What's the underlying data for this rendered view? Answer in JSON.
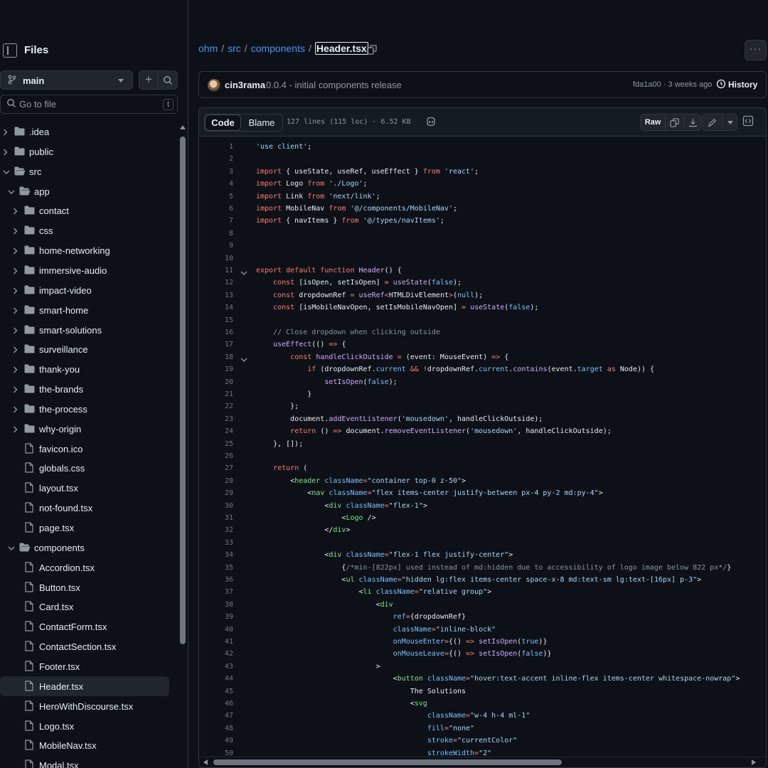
{
  "sidebar": {
    "title": "Files",
    "branch": "main",
    "goto_placeholder": "Go to file",
    "goto_shortcut": "t",
    "tree": [
      {
        "label": ".idea",
        "type": "folder",
        "depth": 0,
        "expanded": false
      },
      {
        "label": "public",
        "type": "folder",
        "depth": 0,
        "expanded": false
      },
      {
        "label": "src",
        "type": "folder",
        "depth": 0,
        "expanded": true
      },
      {
        "label": "app",
        "type": "folder",
        "depth": 1,
        "expanded": true
      },
      {
        "label": "contact",
        "type": "folder",
        "depth": 2,
        "expanded": false
      },
      {
        "label": "css",
        "type": "folder",
        "depth": 2,
        "expanded": false
      },
      {
        "label": "home-networking",
        "type": "folder",
        "depth": 2,
        "expanded": false
      },
      {
        "label": "immersive-audio",
        "type": "folder",
        "depth": 2,
        "expanded": false
      },
      {
        "label": "impact-video",
        "type": "folder",
        "depth": 2,
        "expanded": false
      },
      {
        "label": "smart-home",
        "type": "folder",
        "depth": 2,
        "expanded": false
      },
      {
        "label": "smart-solutions",
        "type": "folder",
        "depth": 2,
        "expanded": false
      },
      {
        "label": "surveillance",
        "type": "folder",
        "depth": 2,
        "expanded": false
      },
      {
        "label": "thank-you",
        "type": "folder",
        "depth": 2,
        "expanded": false
      },
      {
        "label": "the-brands",
        "type": "folder",
        "depth": 2,
        "expanded": false
      },
      {
        "label": "the-process",
        "type": "folder",
        "depth": 2,
        "expanded": false
      },
      {
        "label": "why-origin",
        "type": "folder",
        "depth": 2,
        "expanded": false
      },
      {
        "label": "favicon.ico",
        "type": "file",
        "depth": 2
      },
      {
        "label": "globals.css",
        "type": "file",
        "depth": 2
      },
      {
        "label": "layout.tsx",
        "type": "file",
        "depth": 2
      },
      {
        "label": "not-found.tsx",
        "type": "file",
        "depth": 2
      },
      {
        "label": "page.tsx",
        "type": "file",
        "depth": 2
      },
      {
        "label": "components",
        "type": "folder",
        "depth": 1,
        "expanded": true
      },
      {
        "label": "Accordion.tsx",
        "type": "file",
        "depth": 2
      },
      {
        "label": "Button.tsx",
        "type": "file",
        "depth": 2
      },
      {
        "label": "Card.tsx",
        "type": "file",
        "depth": 2
      },
      {
        "label": "ContactForm.tsx",
        "type": "file",
        "depth": 2
      },
      {
        "label": "ContactSection.tsx",
        "type": "file",
        "depth": 2
      },
      {
        "label": "Footer.tsx",
        "type": "file",
        "depth": 2
      },
      {
        "label": "Header.tsx",
        "type": "file",
        "depth": 2,
        "selected": true
      },
      {
        "label": "HeroWithDiscourse.tsx",
        "type": "file",
        "depth": 2
      },
      {
        "label": "Logo.tsx",
        "type": "file",
        "depth": 2
      },
      {
        "label": "MobileNav.tsx",
        "type": "file",
        "depth": 2
      },
      {
        "label": "Modal.tsx",
        "type": "file",
        "depth": 2
      }
    ]
  },
  "breadcrumb": {
    "repo": "ohm",
    "dir1": "src",
    "dir2": "components",
    "sep": "/",
    "file": "Header.tsx"
  },
  "commit": {
    "author": "cin3rama",
    "message": "0.0.4 - initial components release",
    "meta": "fda1a00 · 3 weeks ago",
    "history_label": "History"
  },
  "file_header": {
    "code_tab": "Code",
    "blame_tab": "Blame",
    "info": "127 lines (115 loc) · 6.52 KB",
    "raw_label": "Raw"
  },
  "code_lines": [
    {
      "n": "1",
      "fold": false,
      "html": "<span class=\"s\">'use client'</span>;"
    },
    {
      "n": "2",
      "fold": false,
      "html": ""
    },
    {
      "n": "3",
      "fold": false,
      "html": "<span class=\"k\">import</span> { useState, useRef, useEffect } <span class=\"k\">from</span> <span class=\"s\">'react'</span>;"
    },
    {
      "n": "4",
      "fold": false,
      "html": "<span class=\"k\">import</span> Logo <span class=\"k\">from</span> <span class=\"s\">'./Logo'</span>;"
    },
    {
      "n": "5",
      "fold": false,
      "html": "<span class=\"k\">import</span> Link <span class=\"k\">from</span> <span class=\"s\">'next/link'</span>;"
    },
    {
      "n": "6",
      "fold": false,
      "html": "<span class=\"k\">import</span> MobileNav <span class=\"k\">from</span> <span class=\"s\">'@/components/MobileNav'</span>;"
    },
    {
      "n": "7",
      "fold": false,
      "html": "<span class=\"k\">import</span> { navItems } <span class=\"k\">from</span> <span class=\"s\">'@/types/navItems'</span>;"
    },
    {
      "n": "8",
      "fold": false,
      "html": ""
    },
    {
      "n": "9",
      "fold": false,
      "html": ""
    },
    {
      "n": "10",
      "fold": false,
      "html": ""
    },
    {
      "n": "11",
      "fold": true,
      "html": "<span class=\"k\">export default function</span> <span class=\"f\">Header</span>() {"
    },
    {
      "n": "12",
      "fold": false,
      "html": "    <span class=\"k\">const</span> [isOpen, setIsOpen] <span class=\"k\">=</span> <span class=\"f\">useState</span>(<span class=\"v\">false</span>);"
    },
    {
      "n": "13",
      "fold": false,
      "html": "    <span class=\"k\">const</span> dropdownRef <span class=\"k\">=</span> <span class=\"f\">useRef</span><span class=\"k\">&lt;</span>HTMLDivElement<span class=\"k\">&gt;</span>(<span class=\"v\">null</span>);"
    },
    {
      "n": "14",
      "fold": false,
      "html": "    <span class=\"k\">const</span> [isMobileNavOpen, setIsMobileNavOpen] <span class=\"k\">=</span> <span class=\"f\">useState</span>(<span class=\"v\">false</span>);"
    },
    {
      "n": "15",
      "fold": false,
      "html": ""
    },
    {
      "n": "16",
      "fold": false,
      "html": "    <span class=\"c\">// Close dropdown when clicking outside</span>"
    },
    {
      "n": "17",
      "fold": false,
      "html": "    <span class=\"f\">useEffect</span>(() <span class=\"k\">=&gt;</span> {"
    },
    {
      "n": "18",
      "fold": true,
      "html": "        <span class=\"k\">const</span> <span class=\"f\">handleClickOutside</span> <span class=\"k\">=</span> (event: MouseEvent) <span class=\"k\">=&gt;</span> {"
    },
    {
      "n": "19",
      "fold": false,
      "html": "            <span class=\"k\">if</span> (dropdownRef.<span class=\"v\">current</span> <span class=\"k\">&amp;&amp;</span> <span class=\"k\">!</span>dropdownRef.<span class=\"v\">current</span>.<span class=\"f\">contains</span>(event.<span class=\"v\">target</span> <span class=\"k\">as</span> Node)) {"
    },
    {
      "n": "20",
      "fold": false,
      "html": "                <span class=\"f\">setIsOpen</span>(<span class=\"v\">false</span>);"
    },
    {
      "n": "21",
      "fold": false,
      "html": "            }"
    },
    {
      "n": "22",
      "fold": false,
      "html": "        };"
    },
    {
      "n": "23",
      "fold": false,
      "html": "        document.<span class=\"f\">addEventListener</span>(<span class=\"s\">'mousedown'</span>, handleClickOutside);"
    },
    {
      "n": "24",
      "fold": false,
      "html": "        <span class=\"k\">return</span> () <span class=\"k\">=&gt;</span> document.<span class=\"f\">removeEventListener</span>(<span class=\"s\">'mousedown'</span>, handleClickOutside);"
    },
    {
      "n": "25",
      "fold": false,
      "html": "    }, []);"
    },
    {
      "n": "26",
      "fold": false,
      "html": ""
    },
    {
      "n": "27",
      "fold": false,
      "html": "    <span class=\"k\">return</span> ("
    },
    {
      "n": "28",
      "fold": false,
      "html": "        &lt;<span class=\"t\">header</span> <span class=\"v\">className</span><span class=\"k\">=</span><span class=\"s\">\"container top-0 z-50\"</span>&gt;"
    },
    {
      "n": "29",
      "fold": false,
      "html": "            &lt;<span class=\"t\">nav</span> <span class=\"v\">className</span><span class=\"k\">=</span><span class=\"s\">\"flex items-center justify-between px-4 py-2 md:py-4\"</span>&gt;"
    },
    {
      "n": "30",
      "fold": false,
      "html": "                &lt;<span class=\"t\">div</span> <span class=\"v\">className</span><span class=\"k\">=</span><span class=\"s\">\"flex-1\"</span>&gt;"
    },
    {
      "n": "31",
      "fold": false,
      "html": "                    &lt;<span class=\"t\">Logo</span> /&gt;"
    },
    {
      "n": "32",
      "fold": false,
      "html": "                &lt;/<span class=\"t\">div</span>&gt;"
    },
    {
      "n": "33",
      "fold": false,
      "html": ""
    },
    {
      "n": "34",
      "fold": false,
      "html": "                &lt;<span class=\"t\">div</span> <span class=\"v\">className</span><span class=\"k\">=</span><span class=\"s\">\"flex-1 flex justify-center\"</span>&gt;"
    },
    {
      "n": "35",
      "fold": false,
      "html": "                    {<span class=\"c\">/*min-[822px] used instead of md:hidden due to accessibility of logo image below 822 px*/</span>}"
    },
    {
      "n": "36",
      "fold": false,
      "html": "                    &lt;<span class=\"t\">ul</span> <span class=\"v\">className</span><span class=\"k\">=</span><span class=\"s\">\"hidden lg:flex items-center space-x-8 md:text-sm lg:text-[16px] p-3\"</span>&gt;"
    },
    {
      "n": "37",
      "fold": false,
      "html": "                        &lt;<span class=\"t\">li</span> <span class=\"v\">className</span><span class=\"k\">=</span><span class=\"s\">\"relative group\"</span>&gt;"
    },
    {
      "n": "38",
      "fold": false,
      "html": "                            &lt;<span class=\"t\">div</span>"
    },
    {
      "n": "39",
      "fold": false,
      "html": "                                <span class=\"v\">ref</span><span class=\"k\">=</span>{dropdownRef}"
    },
    {
      "n": "40",
      "fold": false,
      "html": "                                <span class=\"v\">className</span><span class=\"k\">=</span><span class=\"s\">\"inline-block\"</span>"
    },
    {
      "n": "41",
      "fold": false,
      "html": "                                <span class=\"v\">onMouseEnter</span><span class=\"k\">=</span>{() <span class=\"k\">=&gt;</span> <span class=\"f\">setIsOpen</span>(<span class=\"v\">true</span>)}"
    },
    {
      "n": "42",
      "fold": false,
      "html": "                                <span class=\"v\">onMouseLeave</span><span class=\"k\">=</span>{() <span class=\"k\">=&gt;</span> <span class=\"f\">setIsOpen</span>(<span class=\"v\">false</span>)}"
    },
    {
      "n": "43",
      "fold": false,
      "html": "                            &gt;"
    },
    {
      "n": "44",
      "fold": false,
      "html": "                                &lt;<span class=\"t\">button</span> <span class=\"v\">className</span><span class=\"k\">=</span><span class=\"s\">\"hover:text-accent inline-flex items-center whitespace-nowrap\"</span>&gt;"
    },
    {
      "n": "45",
      "fold": false,
      "html": "                                    The Solutions"
    },
    {
      "n": "46",
      "fold": false,
      "html": "                                    &lt;<span class=\"t\">svg</span>"
    },
    {
      "n": "47",
      "fold": false,
      "html": "                                        <span class=\"v\">className</span><span class=\"k\">=</span><span class=\"s\">\"w-4 h-4 ml-1\"</span>"
    },
    {
      "n": "48",
      "fold": false,
      "html": "                                        <span class=\"v\">fill</span><span class=\"k\">=</span><span class=\"s\">\"none\"</span>"
    },
    {
      "n": "49",
      "fold": false,
      "html": "                                        <span class=\"v\">stroke</span><span class=\"k\">=</span><span class=\"s\">\"currentColor\"</span>"
    },
    {
      "n": "50",
      "fold": false,
      "html": "                                        <span class=\"v\">strokeWidth</span><span class=\"k\">=</span><span class=\"s\">\"2\"</span>"
    }
  ],
  "colors": {
    "bg": "#0d1117",
    "border": "#30363d",
    "link": "#4493f8",
    "muted": "#9198a1",
    "keyword": "#ff7b72",
    "string": "#a5d6ff",
    "function": "#d2a8ff",
    "constant": "#79c0ff",
    "tag": "#7ee787"
  },
  "icons": {
    "sidebar_toggle": "sidebar-panel-icon",
    "branch": "git-branch-icon",
    "add": "plus-icon",
    "search": "search-icon",
    "folder": "folder-icon",
    "file": "file-icon",
    "copy": "copy-icon",
    "more": "kebab-icon",
    "history": "clock-icon",
    "copilot": "copilot-icon",
    "download": "download-icon",
    "edit": "pencil-icon",
    "symbols": "code-square-icon"
  }
}
